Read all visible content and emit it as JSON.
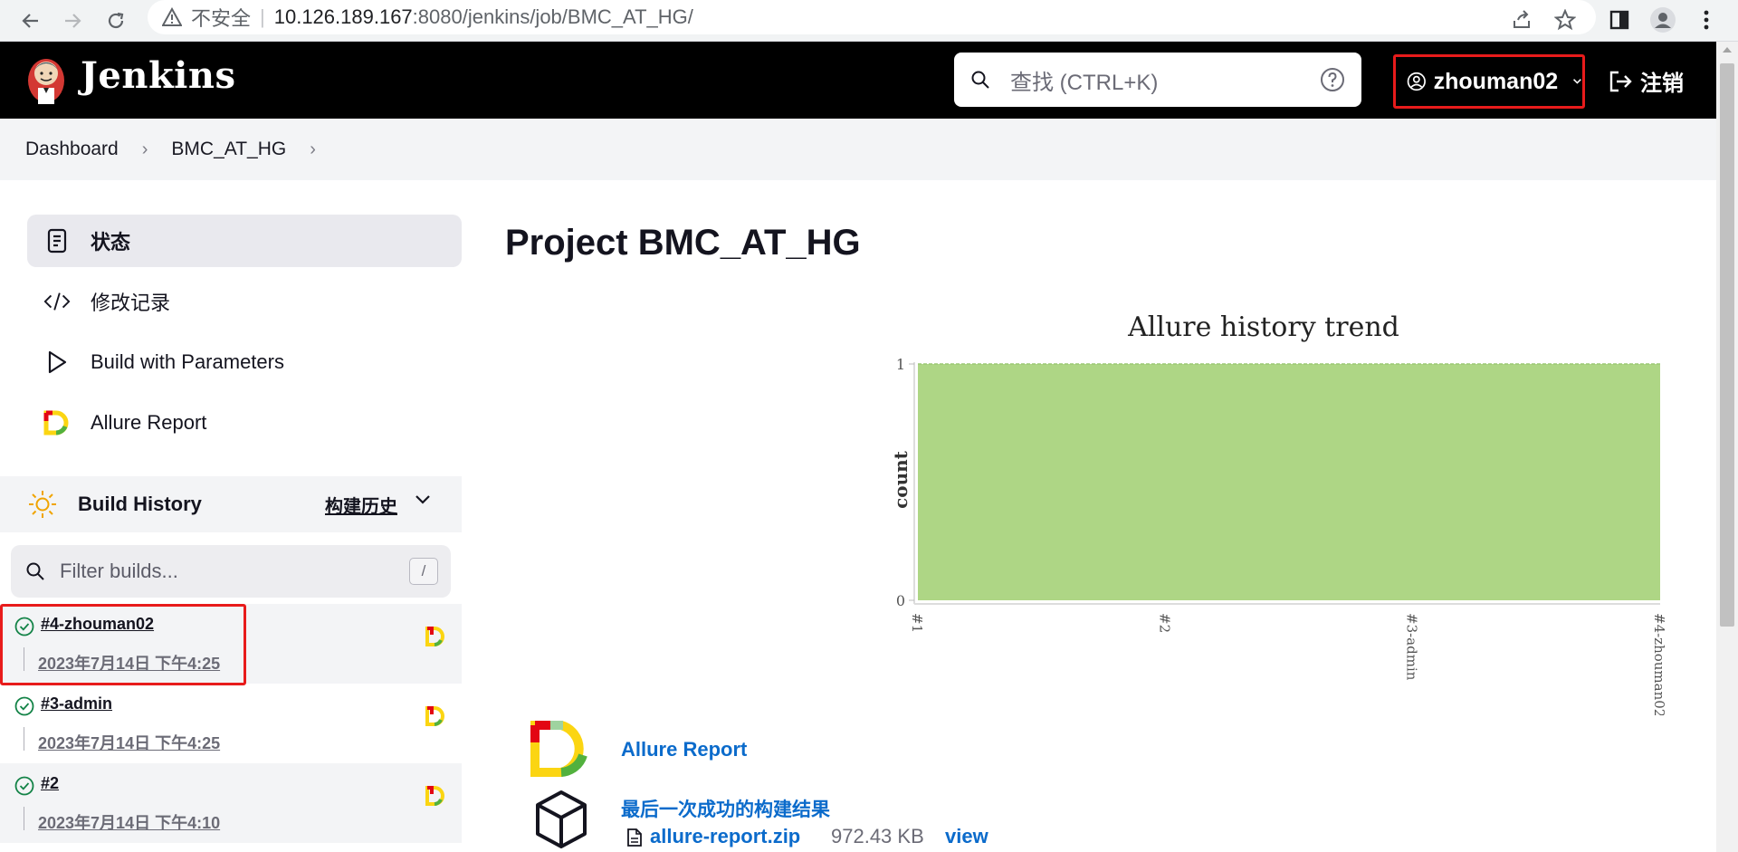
{
  "browser": {
    "insecure_label": "不安全",
    "url_host": "10.126.189.167",
    "url_path": ":8080/jenkins/job/BMC_AT_HG/"
  },
  "header": {
    "app_title": "Jenkins",
    "search_placeholder": "查找 (CTRL+K)",
    "username": "zhouman02",
    "logout_label": "注销"
  },
  "breadcrumb": [
    "Dashboard",
    "BMC_AT_HG"
  ],
  "sidebar": {
    "tasks": [
      {
        "label": "状态",
        "icon": "document-icon"
      },
      {
        "label": "修改记录",
        "icon": "code-icon"
      },
      {
        "label": "Build with Parameters",
        "icon": "play-icon"
      },
      {
        "label": "Allure Report",
        "icon": "allure-icon"
      }
    ]
  },
  "build_history": {
    "title": "Build History",
    "trend_label": "构建历史",
    "filter_placeholder": "Filter builds...",
    "filter_shortcut": "/",
    "builds": [
      {
        "number": "#4-zhouman02",
        "date": "2023年7月14日 下午4:25",
        "status": "success"
      },
      {
        "number": "#3-admin",
        "date": "2023年7月14日 下午4:25",
        "status": "success"
      },
      {
        "number": "#2",
        "date": "2023年7月14日 下午4:10",
        "status": "success"
      }
    ]
  },
  "main": {
    "project_title": "Project BMC_AT_HG",
    "allure_link": "Allure Report",
    "last_success_label": "最后一次成功的构建结果",
    "artifact_name": "allure-report.zip",
    "artifact_size": "972.43 KB",
    "artifact_view": "view"
  },
  "chart_data": {
    "type": "area",
    "title": "Allure history trend",
    "ylabel": "count",
    "xlabel": "",
    "categories": [
      "#1",
      "#2",
      "#3-admin",
      "#4-zhouman02"
    ],
    "series": [
      {
        "values": [
          1,
          1,
          1,
          1
        ],
        "color": "#aed685"
      }
    ],
    "ylim": [
      0,
      1
    ],
    "yticks": [
      "0",
      "1"
    ]
  }
}
